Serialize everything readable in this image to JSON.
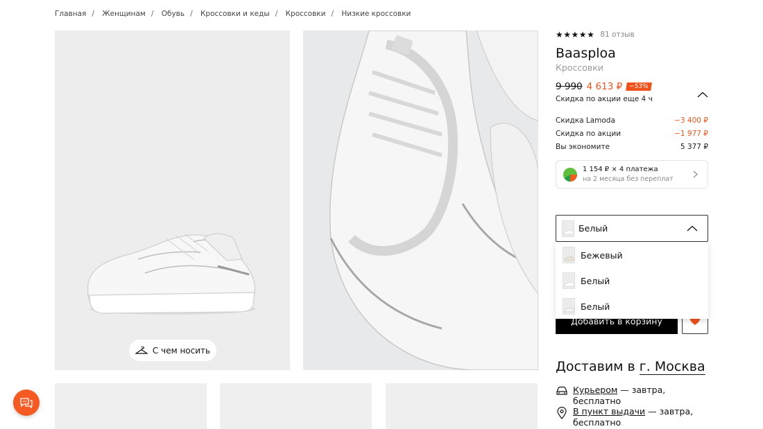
{
  "breadcrumb": [
    "Главная",
    "Женщинам",
    "Обувь",
    "Кроссовки и кеды",
    "Кроссовки",
    "Низкие кроссовки"
  ],
  "gallery": {
    "wear_label": "С чем носить"
  },
  "product": {
    "rating_count": "81 отзыв",
    "rating_stars": 5,
    "brand": "Baasploa",
    "category": "Кроссовки",
    "old_price": "9 990",
    "new_price": "4 613 ₽",
    "discount": "−53%",
    "promo_note": "Скидка по акции еще 4 ч",
    "discounts": [
      {
        "label": "Скидка Lamoda",
        "value": "−3 400 ₽"
      },
      {
        "label": "Скидка по акции",
        "value": "−1 977 ₽"
      },
      {
        "label": "Вы экономите",
        "value": "5 377 ₽"
      }
    ],
    "split": {
      "line1": "1 154 ₽ × 4 платежа",
      "line2": "на 2 месяца без переплат"
    }
  },
  "color_select": {
    "selected": "Белый",
    "options": [
      "Бежевый",
      "Белый",
      "Белый"
    ]
  },
  "buttons": {
    "add_to_cart": "Добавить в корзину"
  },
  "delivery": {
    "title": "Доставим в",
    "city": "г. Москва",
    "courier_link": "Курьером",
    "courier_rest": " — завтра, бесплатно",
    "pickup_link": "В пункт выдачи",
    "pickup_rest": " — завтра, бесплатно"
  },
  "colors": {
    "accent": "#f1511b",
    "chat": "#f45a22"
  },
  "icons": [
    "hanger-icon",
    "star-icon",
    "chevron-up-icon",
    "chevron-right-icon",
    "split-logo-icon",
    "heart-icon",
    "car-icon",
    "location-pin-icon",
    "chat-icon"
  ]
}
